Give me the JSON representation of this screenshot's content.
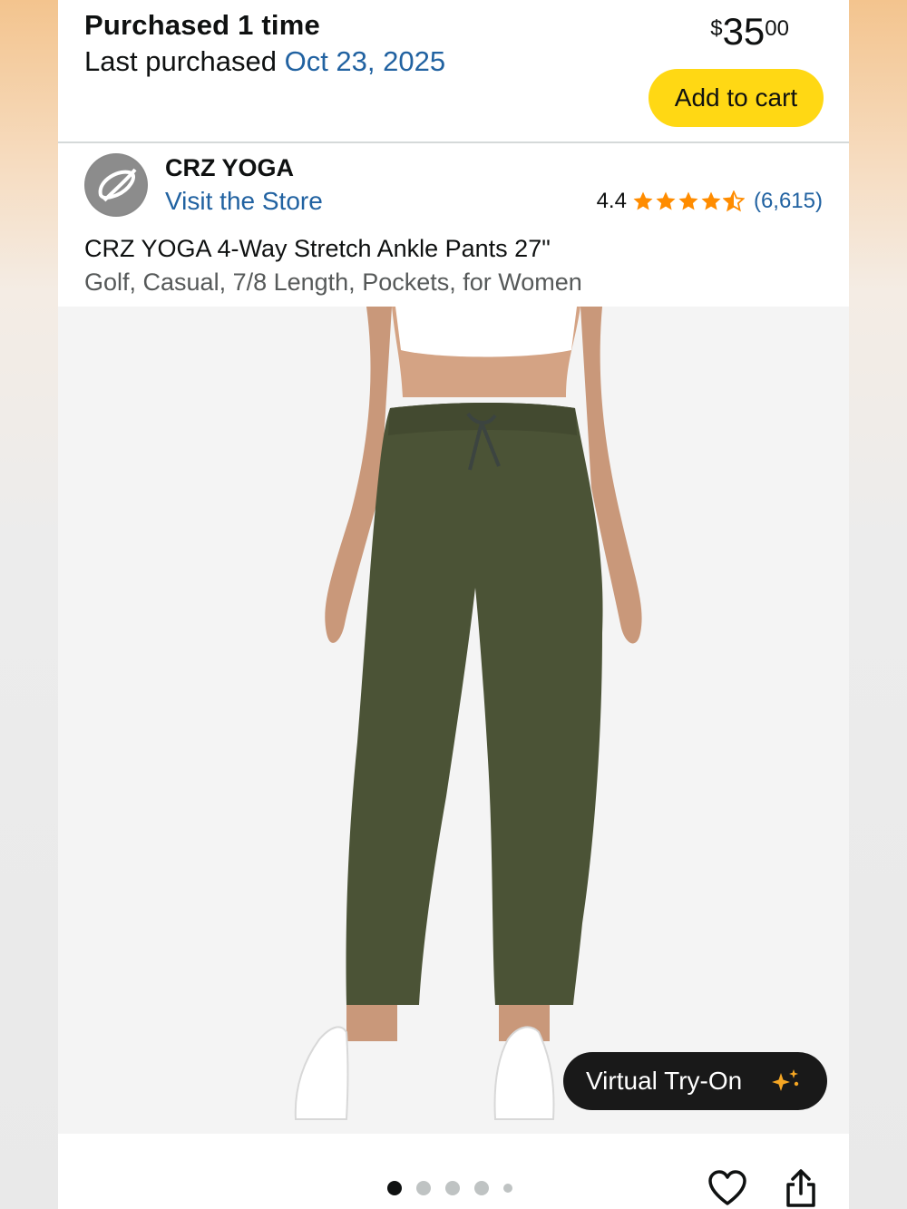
{
  "purchase": {
    "title": "Purchased 1 time",
    "last_label": "Last purchased ",
    "last_date": "Oct 23, 2025"
  },
  "price": {
    "symbol": "$",
    "whole": "35",
    "fraction": "00"
  },
  "buttons": {
    "add_to_cart": "Add to cart",
    "virtual_try_on": "Virtual Try-On"
  },
  "brand": {
    "name": "CRZ YOGA",
    "visit_store": "Visit the Store"
  },
  "rating": {
    "value": "4.4",
    "stars": 4.4,
    "count": "(6,615)"
  },
  "product": {
    "title": "CRZ YOGA 4-Way Stretch Ankle Pants 27\"",
    "subtitle": "Golf, Casual, 7/8 Length, Pockets, for Women"
  },
  "image_carousel": {
    "total": 5,
    "active_index": 0
  },
  "icons": {
    "brand_logo": "crz-yoga-logo",
    "star": "star-icon",
    "sparkle": "sparkle-icon",
    "favorite": "heart-icon",
    "share": "share-icon"
  },
  "colors": {
    "link": "#2162a1",
    "add_to_cart_bg": "#ffd814",
    "star": "#ff8c00",
    "try_on_bg": "#191919",
    "pants": "#4b5336"
  }
}
